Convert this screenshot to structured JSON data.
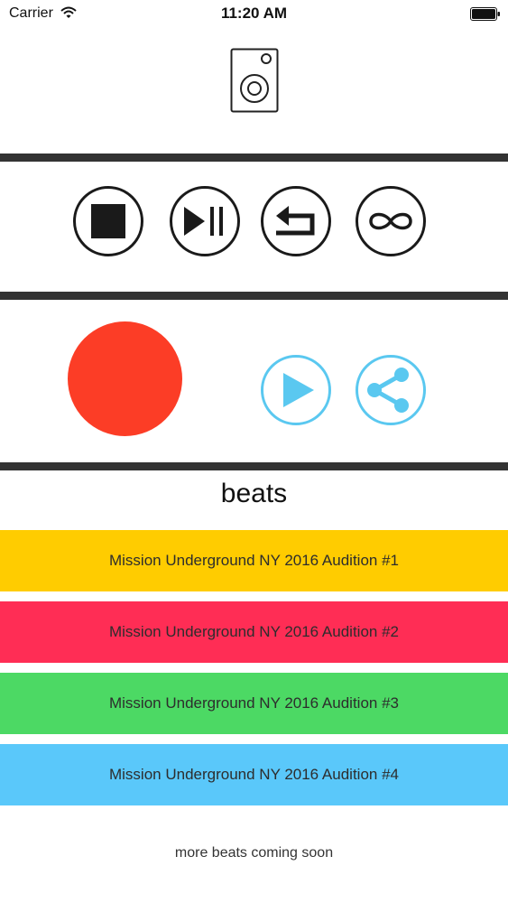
{
  "status_bar": {
    "carrier": "Carrier",
    "time": "11:20 AM"
  },
  "icons": {
    "header": "speaker-icon",
    "stop": "stop-icon",
    "play_pause": "play-pause-icon",
    "return": "return-icon",
    "loop": "infinity-icon",
    "play": "play-icon",
    "share": "share-icon"
  },
  "colors": {
    "divider": "#333333",
    "record": "#fc3d26",
    "accent_blue": "#5ac8f0",
    "row_1": "#ffcc00",
    "row_2": "#ff2d55",
    "row_3": "#4cd964",
    "row_4": "#5ac8fa"
  },
  "beats": {
    "title": "beats",
    "items": [
      {
        "label": "Mission Underground NY 2016 Audition #1"
      },
      {
        "label": "Mission Underground NY 2016 Audition #2"
      },
      {
        "label": "Mission Underground NY 2016 Audition #3"
      },
      {
        "label": "Mission Underground NY 2016 Audition #4"
      }
    ],
    "footer": "more beats coming soon"
  }
}
